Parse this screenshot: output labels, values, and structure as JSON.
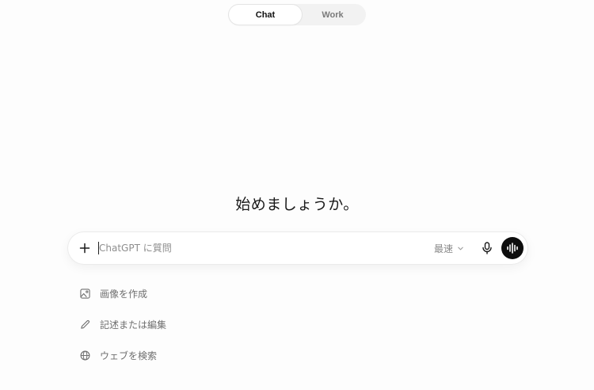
{
  "mode_toggle": {
    "tabs": [
      {
        "label": "Chat",
        "active": true
      },
      {
        "label": "Work",
        "active": false
      }
    ]
  },
  "greeting": "始めましょうか。",
  "composer": {
    "placeholder": "ChatGPT に質問",
    "value": "",
    "model_label": "最速",
    "icons": {
      "attach": "plus-icon",
      "model_dropdown": "chevron-down-icon",
      "dictate": "microphone-icon",
      "voice": "voice-waveform-icon"
    }
  },
  "suggestions": [
    {
      "label": "画像を作成",
      "icon": "image-icon"
    },
    {
      "label": "記述または編集",
      "icon": "pencil-icon"
    },
    {
      "label": "ウェブを検索",
      "icon": "globe-icon"
    }
  ],
  "colors": {
    "background": "#fdfdfd",
    "voice_button": "#0d0d0d",
    "muted_text": "#6f6f6f",
    "toggle_track": "#f2f2f2"
  }
}
